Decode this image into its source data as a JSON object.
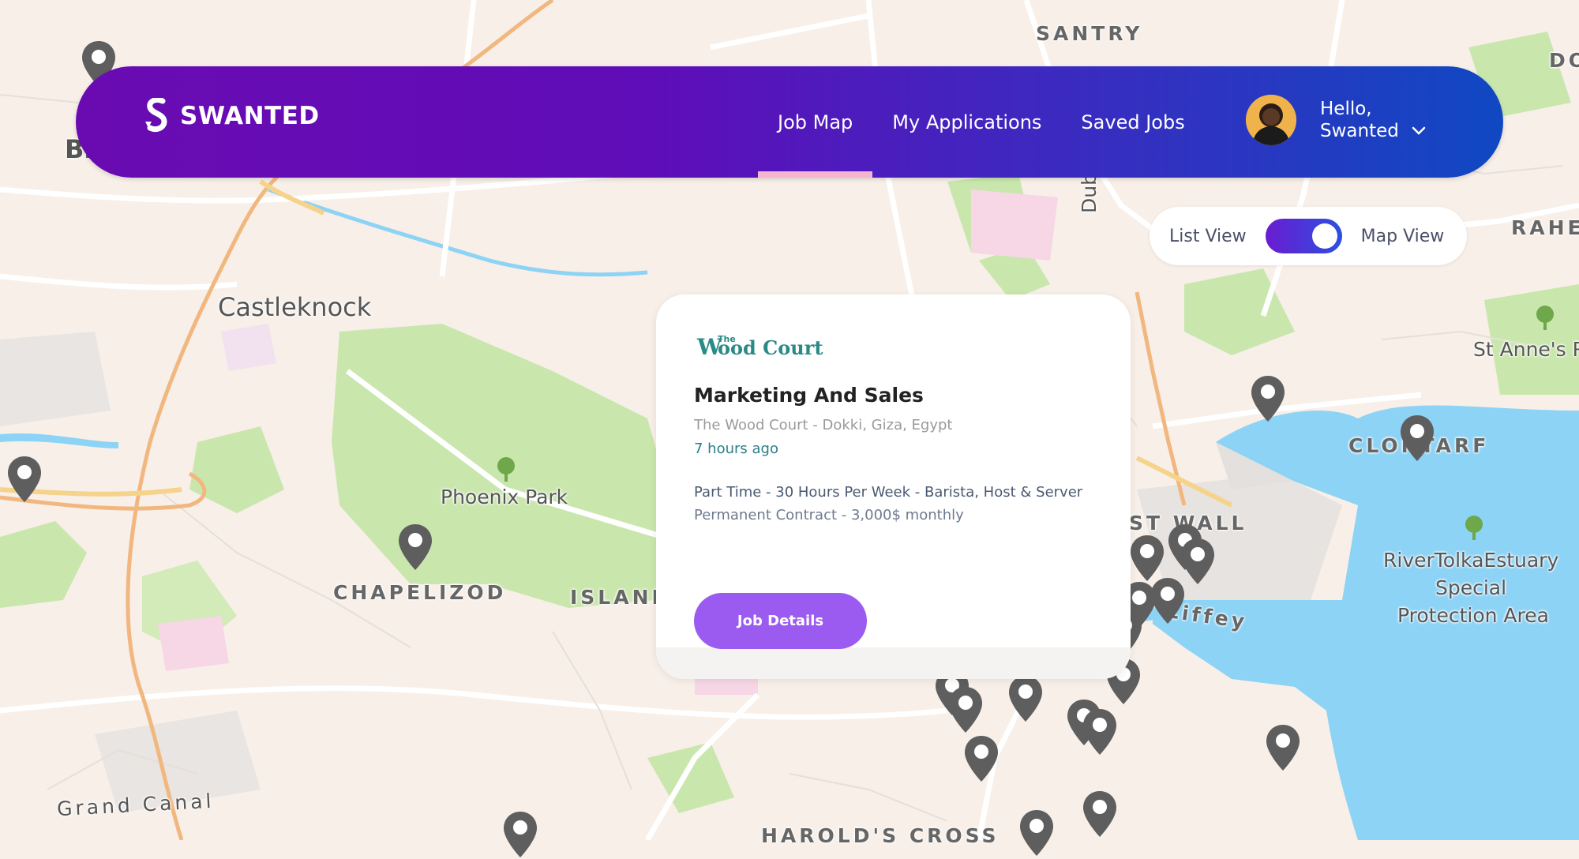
{
  "brand": {
    "name": "SWANTED"
  },
  "nav": {
    "links": [
      {
        "label": "Job Map",
        "active": true
      },
      {
        "label": "My Applications",
        "active": false
      },
      {
        "label": "Saved Jobs",
        "active": false
      }
    ]
  },
  "user": {
    "greeting_line1": "Hello,",
    "greeting_line2": "Swanted"
  },
  "view_toggle": {
    "left_label": "List View",
    "right_label": "Map View",
    "selected": "Map View"
  },
  "job_card": {
    "company_logo_small": "The",
    "company_logo_main": "WoodCourt",
    "title": "Marketing And Sales",
    "company_location": "The Wood Court - Dokki, Giza, Egypt",
    "posted": "7 hours ago",
    "details_line": "Part Time - 30 Hours Per Week - Barista, Host & Server",
    "contract_line": "Permanent Contract - 3,000$ monthly",
    "button_label": "Job Details"
  },
  "map": {
    "labels": {
      "santry": "SANTRY",
      "castleknock": "Castleknock",
      "phoenix_park": "Phoenix Park",
      "chapelizod": "CHAPELIZOD",
      "island": "ISLAND",
      "dublin": "Dublin",
      "raheny": "RAHEN",
      "st_annes": "St Anne's P",
      "clontarf": "CLONTARF",
      "east_wall": "ST WALL",
      "river_tolka": "RiverTolkaEstuary",
      "special": "Special",
      "protection": "Protection Area",
      "liffey": "r Liffey",
      "grand_canal": "Grand Canal",
      "harolds_cross": "HAROLD'S CROSS",
      "do": "DO",
      "bl": "Bl"
    },
    "colors": {
      "water": "#8dd3f5",
      "park": "#c6e6a8",
      "land": "#f7efe8",
      "road": "#ffffff",
      "motorway": "#f1b277",
      "pin": "#5e5e5e"
    }
  },
  "colors": {
    "nav_start": "#6a0bb2",
    "nav_end": "#1048c2",
    "active_underline": "#f7b4d0",
    "button": "#9b5bf0",
    "accent_teal": "#2b7f8c"
  }
}
